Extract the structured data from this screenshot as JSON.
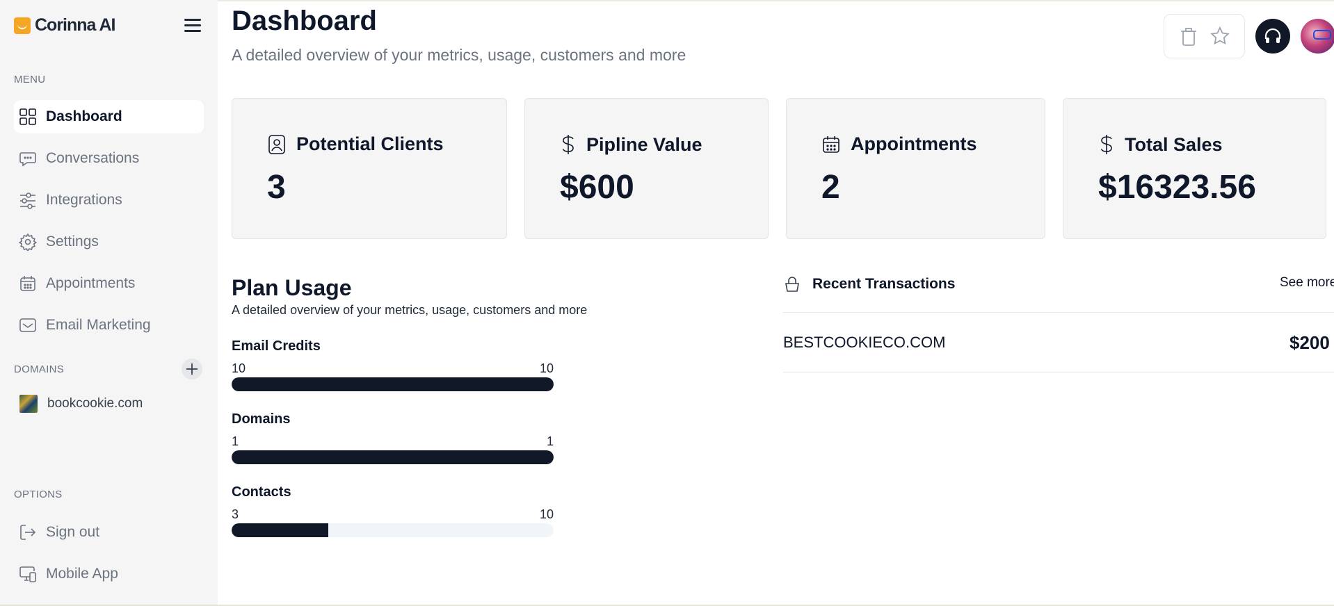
{
  "app": {
    "name": "Corinna AI"
  },
  "sidebar": {
    "menu_label": "MENU",
    "items": [
      {
        "label": "Dashboard",
        "icon": "dashboard-grid-icon",
        "active": true
      },
      {
        "label": "Conversations",
        "icon": "chat-bubble-icon",
        "active": false
      },
      {
        "label": "Integrations",
        "icon": "sliders-icon",
        "active": false
      },
      {
        "label": "Settings",
        "icon": "gear-icon",
        "active": false
      },
      {
        "label": "Appointments",
        "icon": "calendar-icon",
        "active": false
      },
      {
        "label": "Email Marketing",
        "icon": "mail-icon",
        "active": false
      }
    ],
    "domains_label": "DOMAINS",
    "domains": [
      {
        "name": "bookcookie.com"
      }
    ],
    "options_label": "OPTIONS",
    "options": [
      {
        "label": "Sign out",
        "icon": "sign-out-icon"
      },
      {
        "label": "Mobile App",
        "icon": "monitor-smartphone-icon"
      }
    ]
  },
  "header": {
    "title": "Dashboard",
    "subtitle": "A detailed overview of your metrics, usage, customers and more"
  },
  "stats": [
    {
      "title": "Potential Clients",
      "value": "3",
      "icon": "contact-icon"
    },
    {
      "title": "Pipline Value",
      "value": "$600",
      "icon": "dollar-icon"
    },
    {
      "title": "Appointments",
      "value": "2",
      "icon": "calendar-icon"
    },
    {
      "title": "Total Sales",
      "value": "$16323.56",
      "icon": "dollar-icon"
    }
  ],
  "plan_usage": {
    "title": "Plan Usage",
    "subtitle": "A detailed overview of your metrics, usage, customers and more",
    "items": [
      {
        "label": "Email Credits",
        "used": "10",
        "limit": "10",
        "fraction": 1.0
      },
      {
        "label": "Domains",
        "used": "1",
        "limit": "1",
        "fraction": 1.0
      },
      {
        "label": "Contacts",
        "used": "3",
        "limit": "10",
        "fraction": 0.3
      }
    ]
  },
  "transactions": {
    "title": "Recent Transactions",
    "see_more": "See more",
    "rows": [
      {
        "name": "BESTCOOKIECO.COM",
        "amount": "$200"
      }
    ]
  },
  "colors": {
    "sidebar_bg": "#f5f5f5",
    "card_bg": "#f5f5f5",
    "bar_fill": "#111827",
    "bar_track": "#f1f5f9",
    "brand": "#f5a623"
  }
}
